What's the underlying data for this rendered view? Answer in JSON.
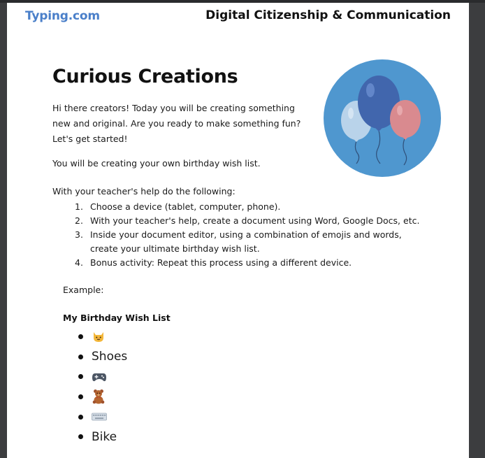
{
  "header": {
    "brand": "Typing.com",
    "title": "Digital Citizenship & Communication"
  },
  "document": {
    "title": "Curious Creations",
    "intro": "Hi there creators! Today you will be creating something new and original. Are you ready to make something fun? Let's get started!",
    "wish_intro": "You will be creating your own birthday wish list.",
    "steps_intro": "With your teacher's help do the following:",
    "steps": [
      {
        "num": "1.",
        "text": "Choose a device (tablet, computer, phone)."
      },
      {
        "num": "2.",
        "text": "With your teacher's help, create a document using Word, Google Docs, etc."
      },
      {
        "num": "3.",
        "text": "Inside your document editor, using a combination of emojis and words, create your ultimate birthday wish list."
      },
      {
        "num": "4.",
        "text": "Bonus activity: Repeat this process using a different device."
      }
    ],
    "example_label": "Example:",
    "wish_list_title": "My Birthday Wish List",
    "wish_list": [
      {
        "icon": "cat-face-icon"
      },
      {
        "text": "Shoes"
      },
      {
        "icon": "game-controller-icon"
      },
      {
        "icon": "teddy-bear-icon"
      },
      {
        "icon": "keyboard-icon"
      },
      {
        "text": "Bike"
      }
    ]
  },
  "colors": {
    "brand": "#4a7fc9",
    "circle": "#4f97cf",
    "balloon_dark": "#4166ad",
    "balloon_light": "#b9d3ea",
    "balloon_pink": "#d98a8f"
  }
}
